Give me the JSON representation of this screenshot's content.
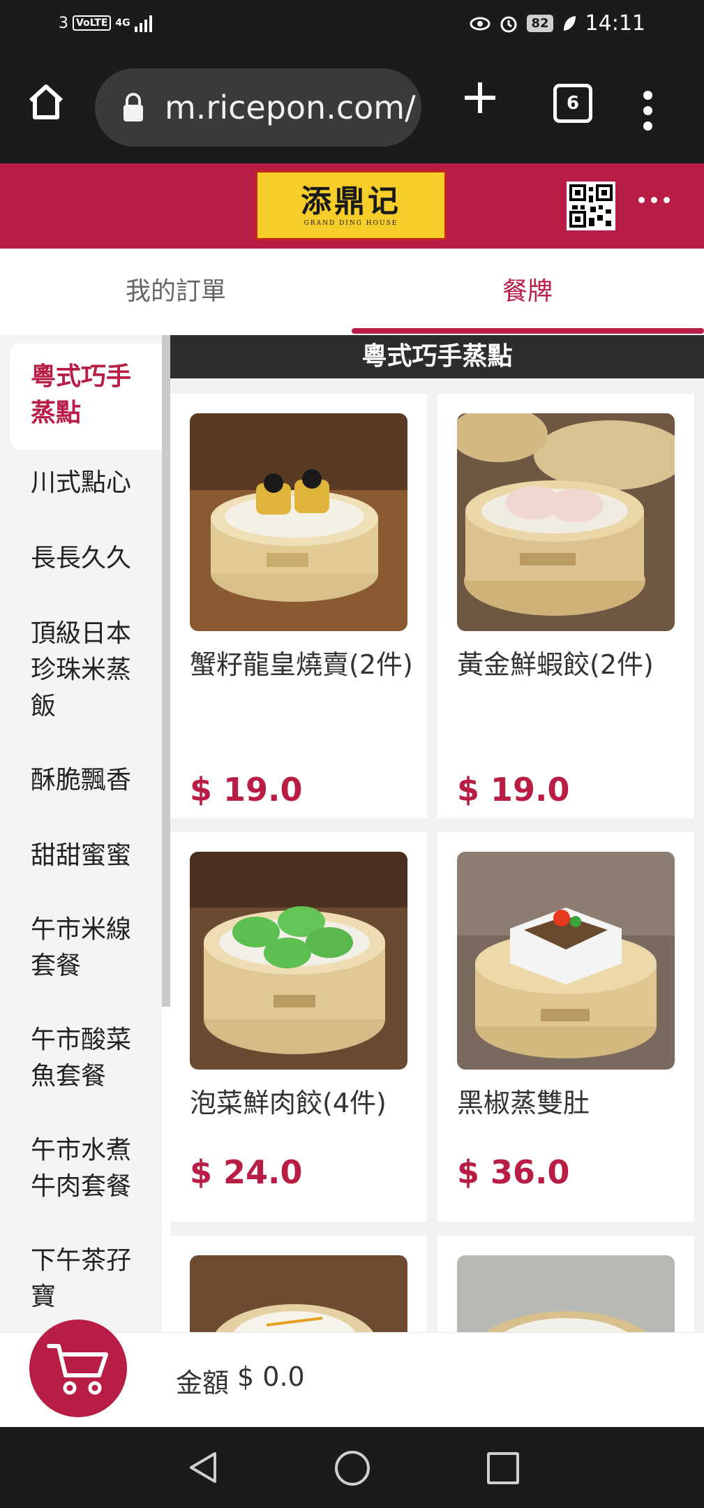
{
  "status_bar": {
    "carrier": "3",
    "volte": "VoLTE",
    "network": "4G",
    "battery": "82",
    "time": "14:11",
    "icons": [
      "eye-comfort-icon",
      "alarm-icon",
      "leaf-icon"
    ]
  },
  "browser": {
    "url": "m.ricepon.com/",
    "tab_count": "6"
  },
  "site": {
    "logo_title": "添鼎记",
    "logo_subtitle": "GRAND DING HOUSE",
    "accent_color": "#b81e45"
  },
  "tabs": [
    {
      "label": "我的訂單",
      "active": false
    },
    {
      "label": "餐牌",
      "active": true
    }
  ],
  "categories": [
    {
      "label": "粵式巧手蒸點",
      "active": true
    },
    {
      "label": "川式點心"
    },
    {
      "label": "長長久久"
    },
    {
      "label": "頂級日本珍珠米蒸飯"
    },
    {
      "label": "酥脆飄香"
    },
    {
      "label": "甜甜蜜蜜"
    },
    {
      "label": "午市米線套餐"
    },
    {
      "label": "午市酸菜魚套餐"
    },
    {
      "label": "午市水煮牛肉套餐"
    },
    {
      "label": "下午茶孖寶"
    }
  ],
  "section_title": "粵式巧手蒸點",
  "items": [
    {
      "name": "蟹籽龍皇燒賣(2件)",
      "price": "$ 19.0"
    },
    {
      "name": "黃金鮮蝦餃(2件)",
      "price": "$ 19.0"
    },
    {
      "name": "泡菜鮮肉餃(4件)",
      "price": "$ 24.0"
    },
    {
      "name": "黑椒蒸雙肚",
      "price": "$ 36.0"
    }
  ],
  "cart": {
    "total_label": "金額",
    "total_value": "$ 0.0"
  }
}
